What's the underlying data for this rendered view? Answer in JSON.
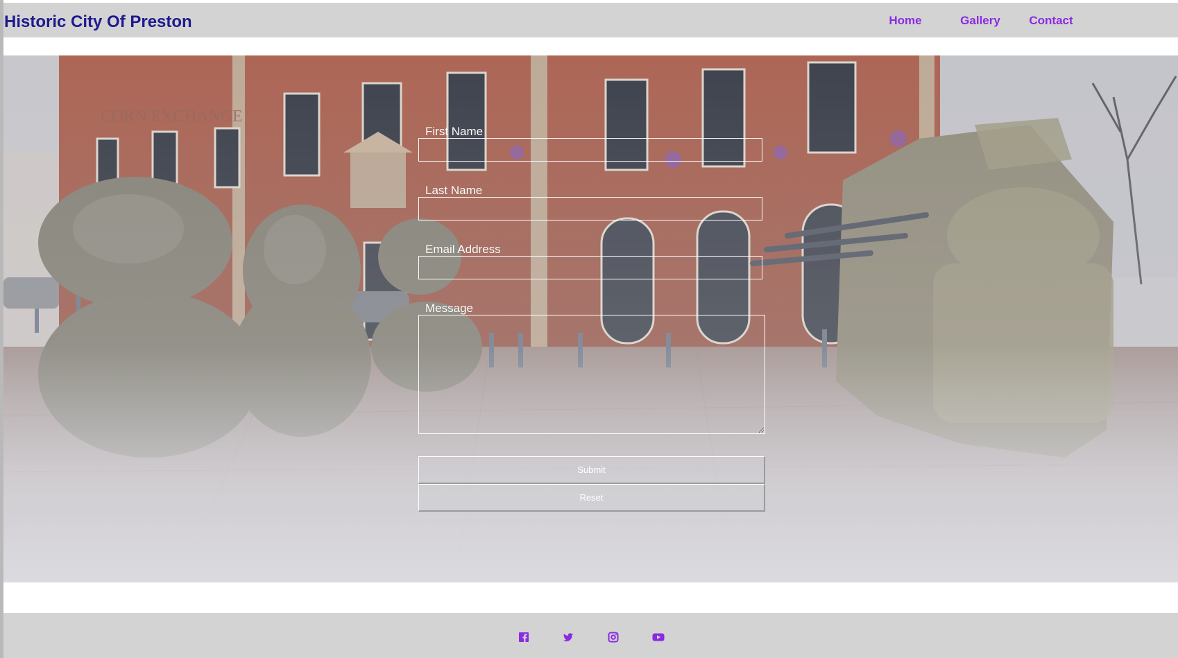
{
  "header": {
    "title": "Historic City Of Preston",
    "nav": [
      "Home",
      "Gallery",
      "Contact"
    ]
  },
  "form": {
    "first_name_label": "First Name",
    "last_name_label": "Last Name",
    "email_label": "Email Address",
    "message_label": "Message",
    "submit_label": "Submit",
    "reset_label": "Reset"
  },
  "footer": {
    "social_icons": [
      "facebook-icon",
      "twitter-icon",
      "instagram-icon",
      "youtube-icon"
    ]
  },
  "colors": {
    "title": "#1f1a8e",
    "nav_link": "#8a2be2",
    "header_bg": "#d3d3d3",
    "footer_bg": "#d3d3d3"
  }
}
